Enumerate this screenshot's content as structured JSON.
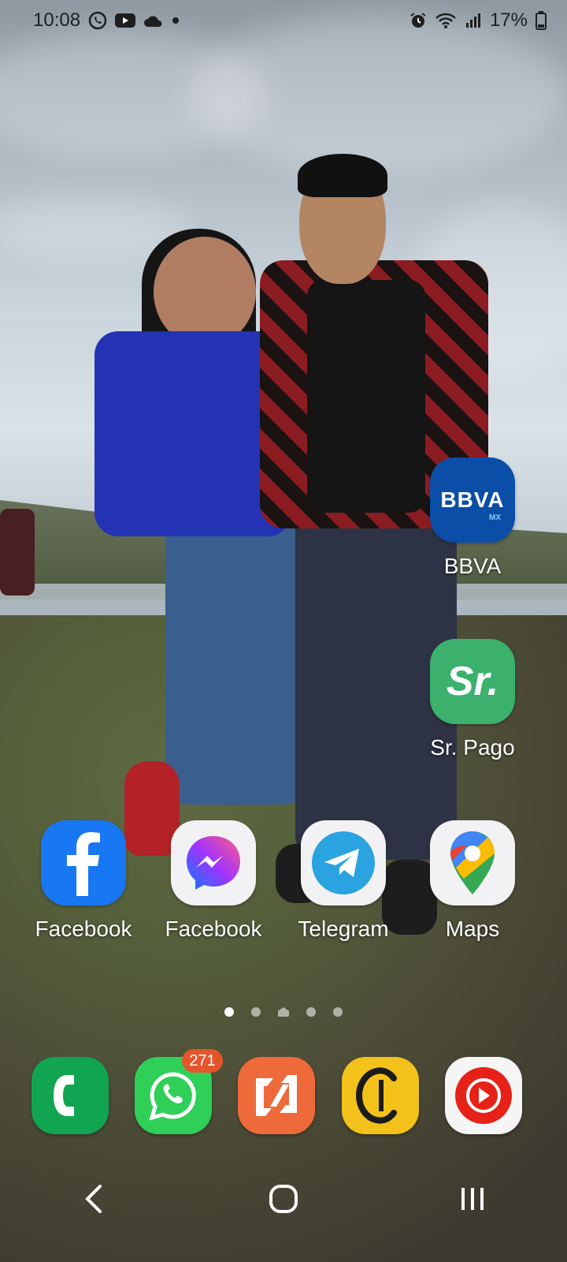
{
  "status_bar": {
    "time": "10:08",
    "battery_percent": "17%",
    "left_icons": [
      "whatsapp-icon",
      "youtube-icon",
      "cloud-icon",
      "dot-icon"
    ],
    "right_icons": [
      "alarm-icon",
      "wifi-icon",
      "signal-icon",
      "battery-icon"
    ]
  },
  "home": {
    "apps": [
      {
        "label": "BBVA",
        "icon": "bbva-icon"
      },
      {
        "label": "Sr. Pago",
        "icon": "sr-pago-icon"
      },
      {
        "label": "Facebook",
        "icon": "facebook-icon"
      },
      {
        "label": "Facebook",
        "icon": "messenger-icon"
      },
      {
        "label": "Telegram",
        "icon": "telegram-icon"
      },
      {
        "label": "Maps",
        "icon": "maps-icon"
      }
    ],
    "bbva_text": "BBVA",
    "bbva_sub": "MX",
    "srpago_text": "Sr."
  },
  "page_indicator": {
    "pages": 5,
    "active_index": 0
  },
  "dock": {
    "apps": [
      {
        "name": "Phone",
        "icon": "phone-icon"
      },
      {
        "name": "WhatsApp",
        "icon": "whatsapp-icon",
        "badge": "271"
      },
      {
        "name": "Zoho",
        "icon": "zoho-icon"
      },
      {
        "name": "Coppel",
        "icon": "coppel-icon"
      },
      {
        "name": "YouTube Music",
        "icon": "youtube-music-icon"
      }
    ]
  },
  "nav_bar": {
    "buttons": [
      "back-icon",
      "home-icon",
      "recents-icon"
    ]
  },
  "colors": {
    "bbva": "#0a4ea8",
    "sr_pago": "#3bb16d",
    "facebook": "#1877f2",
    "telegram": "#2aa3e0",
    "whatsapp": "#2fcf58",
    "zoho": "#ee6a3a",
    "coppel": "#f2c21b",
    "youtube_music": "#e62117",
    "badge": "#e4552b"
  }
}
